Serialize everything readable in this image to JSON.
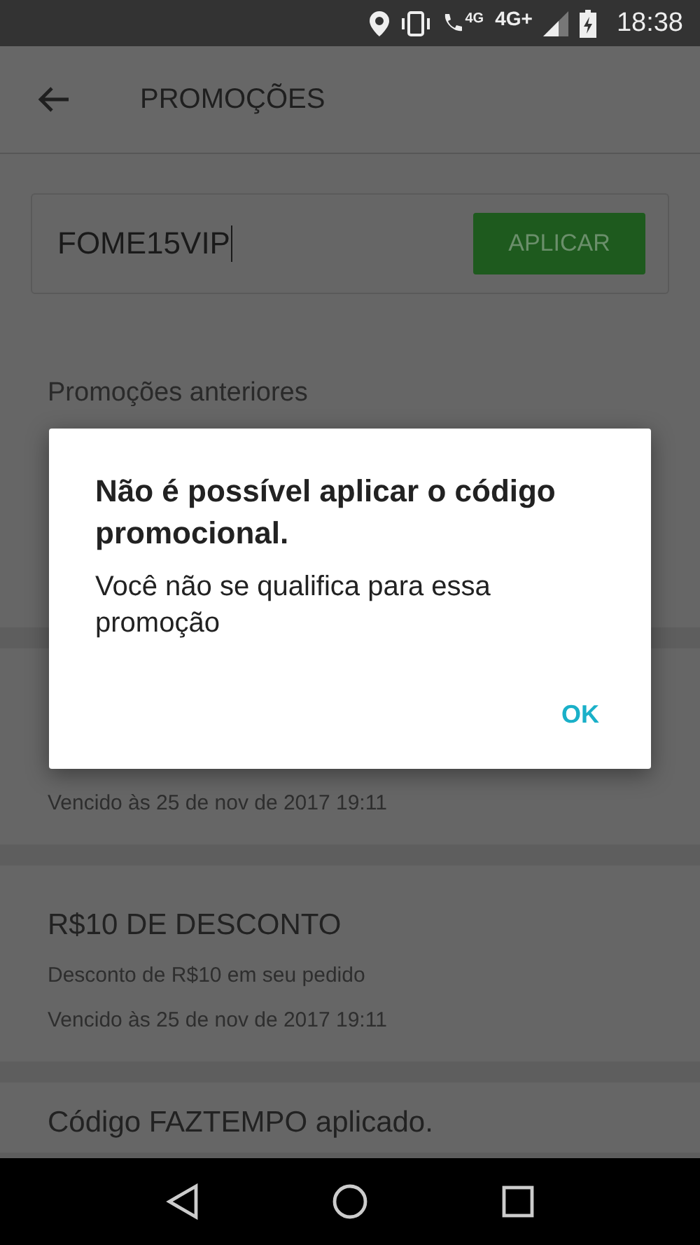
{
  "status_bar": {
    "network_labels": [
      "4G",
      "4G+"
    ],
    "time": "18:38"
  },
  "app_bar": {
    "title": "PROMOÇÕES"
  },
  "promo_input": {
    "value": "FOME15VIP",
    "button": "APLICAR"
  },
  "section_title": "Promoções anteriores",
  "promotions": [
    {
      "expiry": "Vencido às 25 de nov de 2017 19:11"
    },
    {
      "title": "R$10 DE DESCONTO",
      "description": "Desconto de R$10 em seu pedido",
      "expiry": "Vencido às 25 de nov de 2017 19:11"
    },
    {
      "title": "Código FAZTEMPO aplicado."
    }
  ],
  "dialog": {
    "title": "Não é possível aplicar o código promocional.",
    "message": "Você não se qualifica para essa promoção",
    "button": "OK"
  }
}
